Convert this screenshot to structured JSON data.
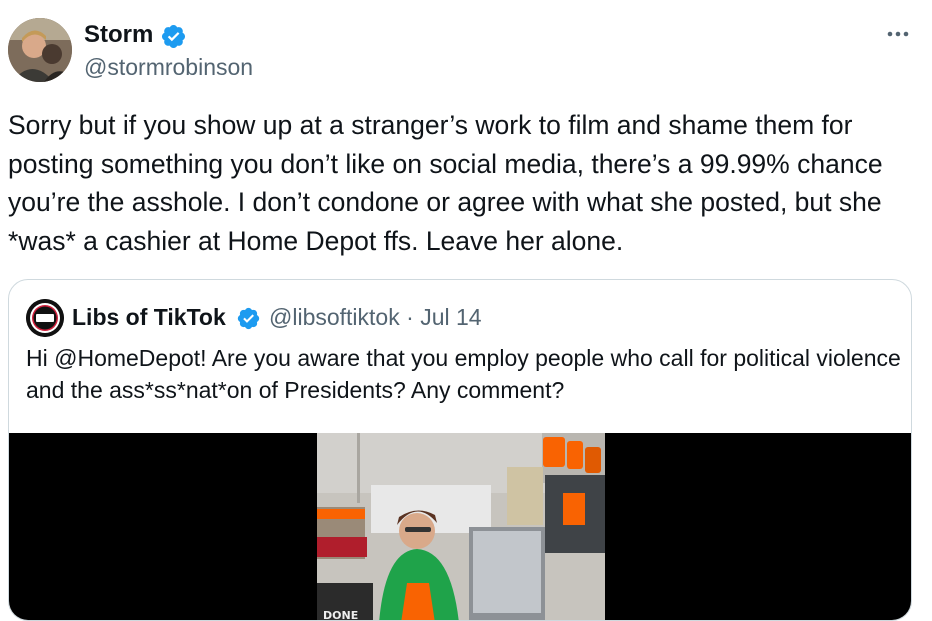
{
  "tweet": {
    "author_name": "Storm",
    "author_handle": "@stormrobinson",
    "more_icon": "more-horizontal-icon",
    "verified_icon": "verified-badge-icon",
    "text": "Sorry but if you show up at a stranger’s work to film and shame them for posting something you don’t like on social media, there’s a 99.99% chance you’re the asshole. I don’t condone or agree with what she posted, but she *was* a cashier at Home Depot ffs. Leave her alone."
  },
  "quoted_tweet": {
    "author_name": "Libs of TikTok",
    "author_handle": "@libsoftiktok",
    "separator": "·",
    "date": "Jul 14",
    "text": "Hi @HomeDepot! Are you aware that you employ people who call for political violence and the ass*ss*nat*on of Presidents? Any comment?",
    "video_overlay_text": "DONE"
  },
  "colors": {
    "verified_blue": "#1d9bf0",
    "secondary_text": "#536471",
    "home_depot_orange": "#f96302",
    "employee_vest_green": "#1fa34a"
  }
}
